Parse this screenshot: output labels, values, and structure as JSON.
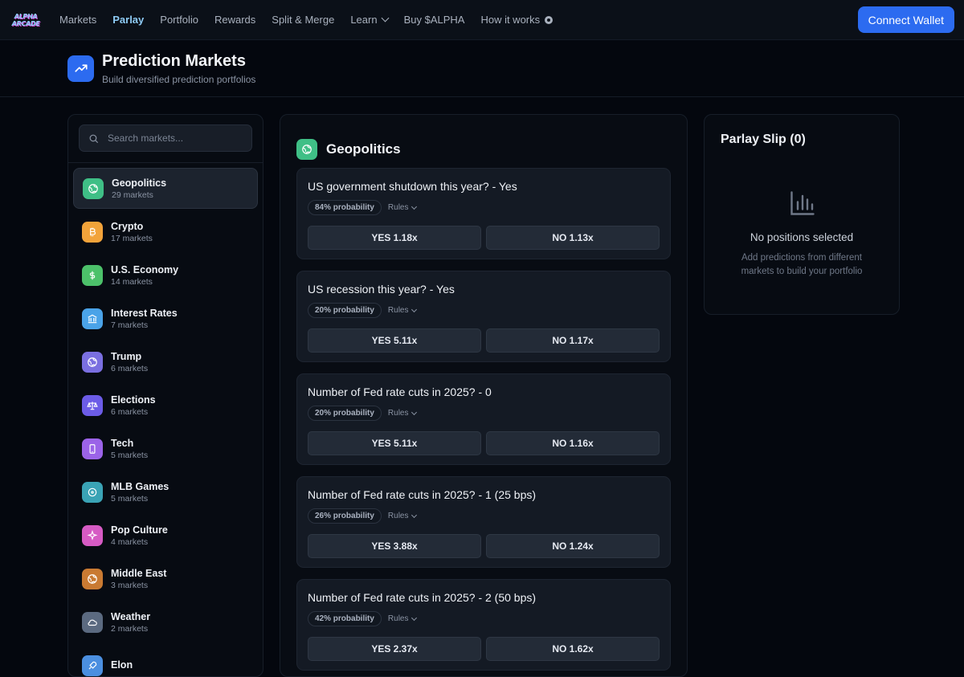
{
  "nav": {
    "logo_line1": "ALPHA",
    "logo_line2": "ARCADE",
    "links": [
      "Markets",
      "Parlay",
      "Portfolio",
      "Rewards",
      "Split & Merge",
      "Learn",
      "Buy $ALPHA",
      "How it works"
    ],
    "active": "Parlay",
    "connect_label": "Connect Wallet",
    "accent": "#2c6bf0"
  },
  "header": {
    "title": "Prediction Markets",
    "subtitle": "Build diversified prediction portfolios",
    "icon": "trending-up-icon"
  },
  "sidebar": {
    "search_placeholder": "Search markets...",
    "categories": [
      {
        "name": "Geopolitics",
        "count": "29 markets",
        "icon": "globe-icon",
        "color": "#3fbf86"
      },
      {
        "name": "Crypto",
        "count": "17 markets",
        "icon": "bitcoin-icon",
        "color": "#f2a33a"
      },
      {
        "name": "U.S. Economy",
        "count": "14 markets",
        "icon": "dollar-icon",
        "color": "#4cc16a"
      },
      {
        "name": "Interest Rates",
        "count": "7 markets",
        "icon": "bank-icon",
        "color": "#4aa3e8"
      },
      {
        "name": "Trump",
        "count": "6 markets",
        "icon": "globe-icon",
        "color": "#7a6fe0"
      },
      {
        "name": "Elections",
        "count": "6 markets",
        "icon": "scale-icon",
        "color": "#6c5ce7"
      },
      {
        "name": "Tech",
        "count": "5 markets",
        "icon": "phone-icon",
        "color": "#9b63e8"
      },
      {
        "name": "MLB Games",
        "count": "5 markets",
        "icon": "target-icon",
        "color": "#3aa3b5"
      },
      {
        "name": "Pop Culture",
        "count": "4 markets",
        "icon": "sparkle-icon",
        "color": "#d65bc4"
      },
      {
        "name": "Middle East",
        "count": "3 markets",
        "icon": "globe-icon",
        "color": "#c97a32"
      },
      {
        "name": "Weather",
        "count": "2 markets",
        "icon": "cloud-icon",
        "color": "#5b6a80"
      },
      {
        "name": "Elon",
        "count": "",
        "icon": "rocket-icon",
        "color": "#4b8fe0"
      }
    ]
  },
  "main": {
    "title": "Geopolitics",
    "markets": [
      {
        "question": "US government shutdown this year? - Yes",
        "probability": "84% probability",
        "rules": "Rules",
        "yes": "YES 1.18x",
        "no": "NO 1.13x"
      },
      {
        "question": "US recession this year? - Yes",
        "probability": "20% probability",
        "rules": "Rules",
        "yes": "YES 5.11x",
        "no": "NO 1.17x"
      },
      {
        "question": "Number of Fed rate cuts in 2025? - 0",
        "probability": "20% probability",
        "rules": "Rules",
        "yes": "YES 5.11x",
        "no": "NO 1.16x"
      },
      {
        "question": "Number of Fed rate cuts in 2025? - 1 (25 bps)",
        "probability": "26% probability",
        "rules": "Rules",
        "yes": "YES 3.88x",
        "no": "NO 1.24x"
      },
      {
        "question": "Number of Fed rate cuts in 2025? - 2 (50 bps)",
        "probability": "42% probability",
        "rules": "Rules",
        "yes": "YES 2.37x",
        "no": "NO 1.62x"
      }
    ]
  },
  "slip": {
    "title": "Parlay Slip (0)",
    "empty": "No positions selected",
    "hint": "Add predictions from different markets to build your portfolio"
  }
}
